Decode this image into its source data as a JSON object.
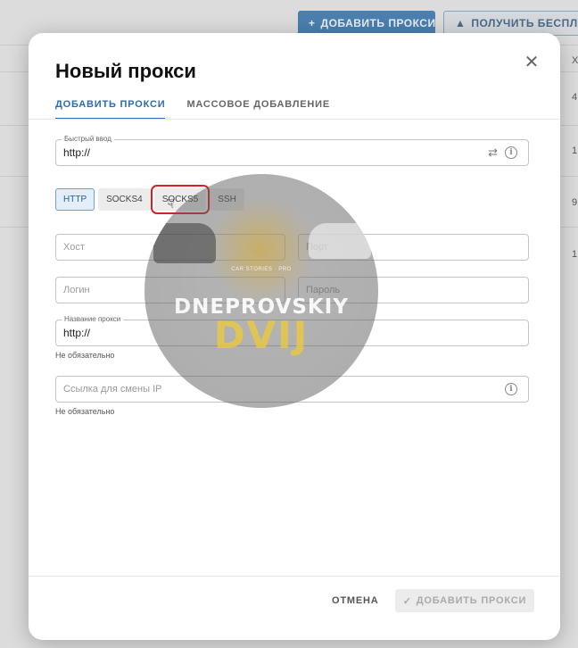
{
  "background": {
    "add_proxy_button": "ДОБАВИТЬ ПРОКСИ",
    "get_free_button": "ПОЛУЧИТЬ БЕСПЛАТ",
    "column_header": "Х",
    "cells": [
      "4",
      "1",
      "9",
      "1"
    ]
  },
  "modal": {
    "title": "Новый прокси",
    "tabs": [
      {
        "label": "ДОБАВИТЬ ПРОКСИ",
        "active": true
      },
      {
        "label": "МАССОВОЕ ДОБАВЛЕНИЕ",
        "active": false
      }
    ],
    "quick_input": {
      "label": "Быстрый ввод",
      "value": "http://"
    },
    "protocols": [
      {
        "label": "HTTP",
        "state": "active"
      },
      {
        "label": "SOCKS4",
        "state": "normal"
      },
      {
        "label": "SOCKS5",
        "state": "highlighted"
      },
      {
        "label": "SSH",
        "state": "normal"
      }
    ],
    "host": {
      "placeholder": "Хост"
    },
    "port": {
      "placeholder": "Порт"
    },
    "login": {
      "placeholder": "Логин"
    },
    "password": {
      "placeholder": "Пароль"
    },
    "proxy_name": {
      "label": "Название прокси",
      "value": "http://",
      "helper": "Не обязательно"
    },
    "change_ip_link": {
      "placeholder": "Ссылка для смены IP",
      "helper": "Не обязательно"
    },
    "footer": {
      "cancel_label": "ОТМЕНА",
      "submit_label": "ДОБАВИТЬ ПРОКСИ"
    }
  },
  "watermark": {
    "small_text": "CAR STORIES · PRO",
    "name": "DNEPROVSKIY",
    "big": "DVIJ"
  },
  "colors": {
    "accent": "#2a6db0",
    "highlight": "#d42323"
  }
}
